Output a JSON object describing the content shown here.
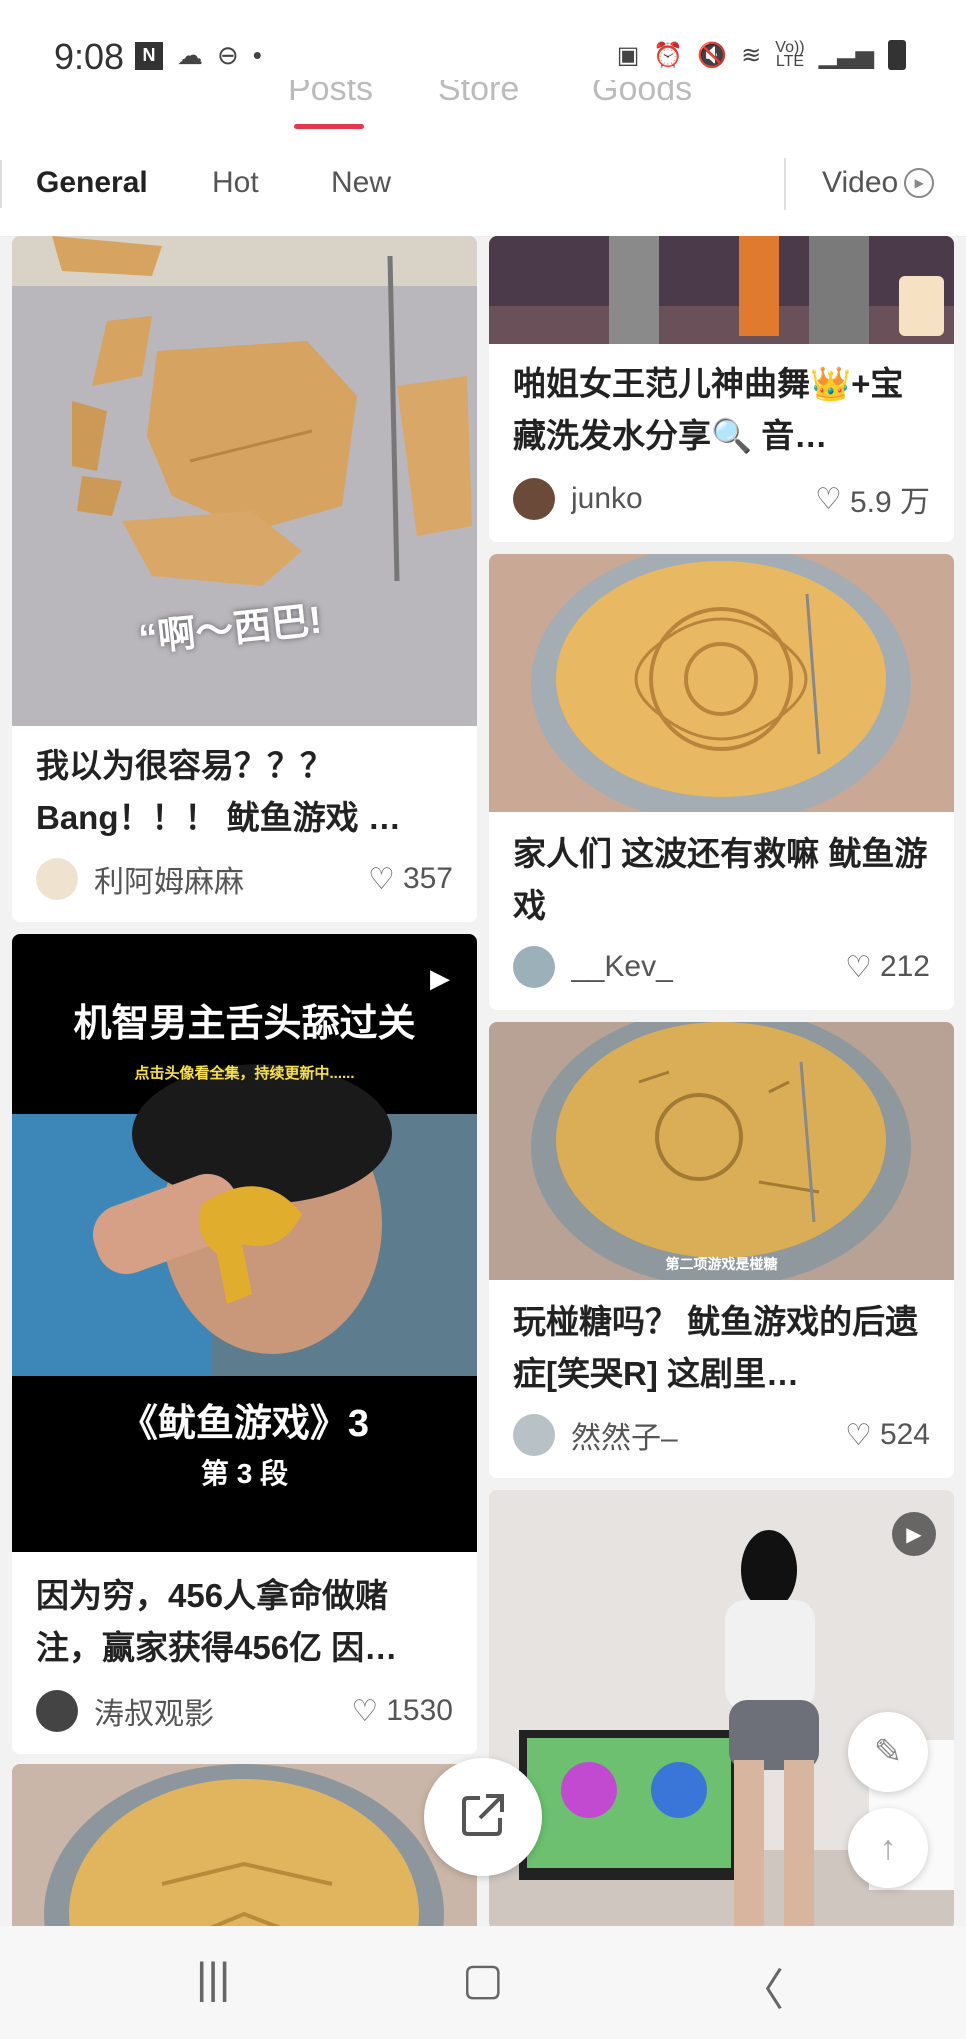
{
  "status": {
    "time": "9:08",
    "network_badge": "LTE",
    "network_prefix": "Vo))"
  },
  "top_tabs": [
    "Posts",
    "Store",
    "Goods"
  ],
  "sub_tabs": {
    "general": "General",
    "hot": "Hot",
    "new": "New",
    "video": "Video"
  },
  "cards": [
    {
      "title": "我以为很容易？？？ Bang！！！ 鱿鱼游戏 …",
      "author": "利阿姆麻麻",
      "likes": "357",
      "overlay": "“啊～西巴!"
    },
    {
      "title": "因为穷，456人拿命做赌注，赢家获得456亿 因…",
      "author": "涛叔观影",
      "likes": "1530",
      "overlay_line1": "机智男主舌头舔过关",
      "overlay_line2": "点击头像看全集，持续更新中......",
      "overlay_line3": "《鱿鱼游戏》3",
      "overlay_line4": "第 3 段"
    },
    {
      "title": "啪姐女王范儿神曲舞👑+宝藏洗发水分享🔍 音…",
      "author": "junko",
      "likes": "5.9 万"
    },
    {
      "title": "家人们 这波还有救嘛 鱿鱼游戏",
      "author": "__Kev_",
      "likes": "212"
    },
    {
      "title": "玩椪糖吗？ 鱿鱼游戏的后遗症[笑哭R] 这剧里…",
      "author": "然然子–",
      "likes": "524",
      "overlay": "第二项游戏是椪糖"
    }
  ],
  "colors": {
    "accent": "#e5374d"
  }
}
